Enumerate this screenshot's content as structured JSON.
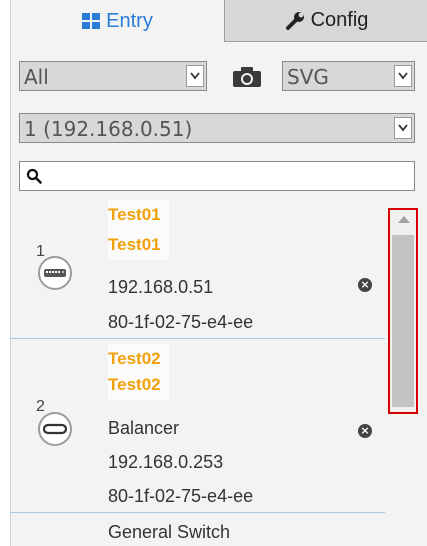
{
  "tabs": {
    "entry_label": "Entry",
    "config_label": "Config"
  },
  "filters": {
    "type_value": "All",
    "format_value": "SVG",
    "device_value": "1 (192.168.0.51)"
  },
  "search": {
    "value": "",
    "placeholder": ""
  },
  "entries": [
    {
      "index": "1",
      "name1": "Test01",
      "name2": "Test01",
      "ip": "192.168.0.51",
      "mac": "80-1f-02-75-e4-ee",
      "icon": "switch-device-icon"
    },
    {
      "index": "2",
      "name1": "Test02",
      "name2": "Test02",
      "type": "Balancer",
      "ip": "192.168.0.253",
      "mac": "80-1f-02-75-e4-ee",
      "icon": "balancer-device-icon"
    }
  ],
  "partial_entry": {
    "type": "General Switch"
  },
  "colors": {
    "accent": "#2a7ed8",
    "name_highlight": "#f0a10a",
    "scroll_highlight": "#d40000",
    "separator": "#a9c8e6"
  }
}
